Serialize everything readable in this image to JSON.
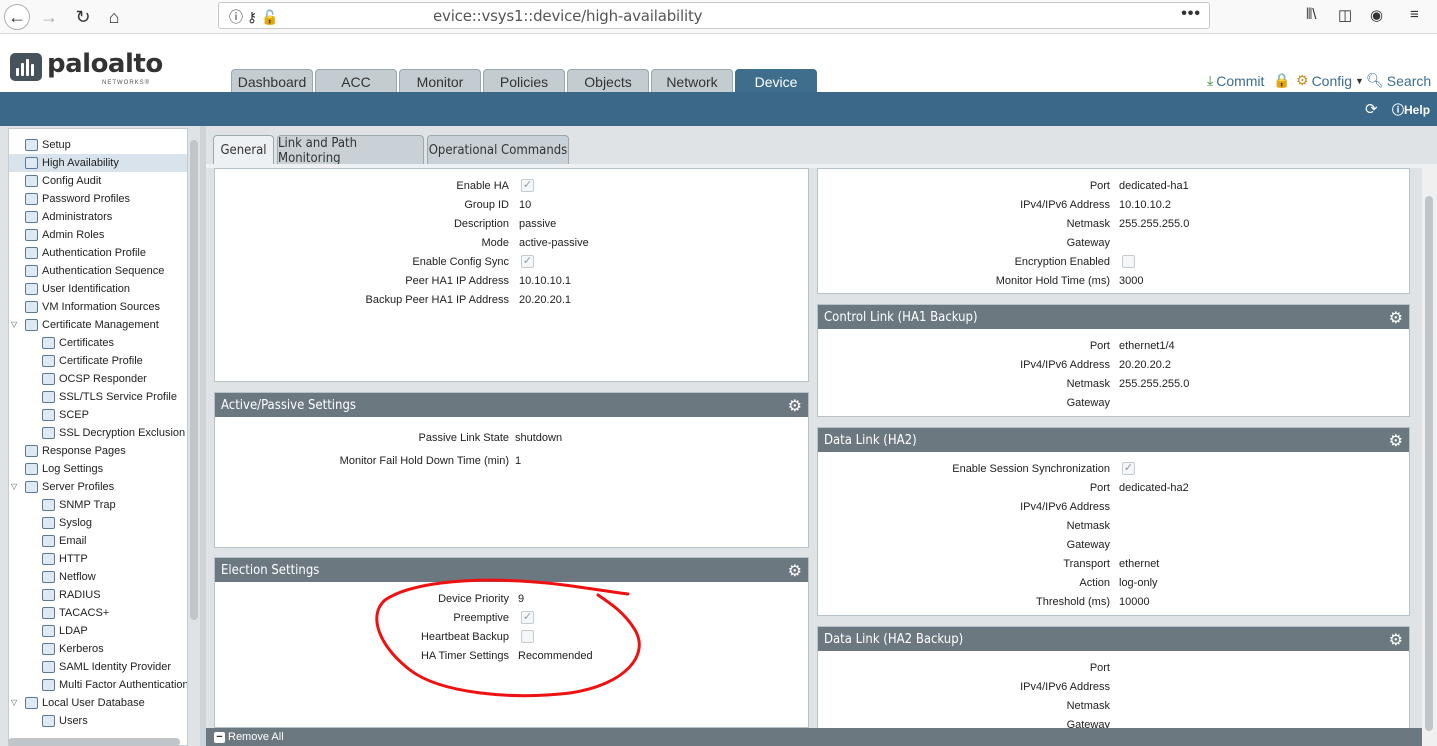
{
  "browser": {
    "url": "evice::vsys1::device/high-availability",
    "more": "•••"
  },
  "brand": {
    "name": "paloalto",
    "sub": "NETWORKS®"
  },
  "main_tabs": [
    {
      "label": "Dashboard"
    },
    {
      "label": "ACC"
    },
    {
      "label": "Monitor"
    },
    {
      "label": "Policies"
    },
    {
      "label": "Objects"
    },
    {
      "label": "Network"
    },
    {
      "label": "Device"
    }
  ],
  "header_actions": {
    "commit": "Commit",
    "config": "Config",
    "search": "Search",
    "help": "Help"
  },
  "sidebar": [
    "Setup",
    "High Availability",
    "Config Audit",
    "Password Profiles",
    "Administrators",
    "Admin Roles",
    "Authentication Profile",
    "Authentication Sequence",
    "User Identification",
    "VM Information Sources",
    "Certificate Management",
    "Certificates",
    "Certificate Profile",
    "OCSP Responder",
    "SSL/TLS Service Profile",
    "SCEP",
    "SSL Decryption Exclusion",
    "Response Pages",
    "Log Settings",
    "Server Profiles",
    "SNMP Trap",
    "Syslog",
    "Email",
    "HTTP",
    "Netflow",
    "RADIUS",
    "TACACS+",
    "LDAP",
    "Kerberos",
    "SAML Identity Provider",
    "Multi Factor Authentication",
    "Local User Database",
    "Users"
  ],
  "sub_tabs": [
    "General",
    "Link and Path Monitoring",
    "Operational Commands"
  ],
  "setup": {
    "enable_ha_label": "Enable HA",
    "group_id_label": "Group ID",
    "group_id": "10",
    "description_label": "Description",
    "description": "passive",
    "mode_label": "Mode",
    "mode": "active-passive",
    "config_sync_label": "Enable Config Sync",
    "peer_ha1_label": "Peer HA1 IP Address",
    "peer_ha1": "10.10.10.1",
    "backup_peer_label": "Backup Peer HA1 IP Address",
    "backup_peer": "20.20.20.1"
  },
  "active_passive": {
    "title": "Active/Passive Settings",
    "link_state_label": "Passive Link State",
    "link_state": "shutdown",
    "hold_label": "Monitor Fail Hold Down Time (min)",
    "hold": "1"
  },
  "election": {
    "title": "Election Settings",
    "priority_label": "Device Priority",
    "priority": "9",
    "preemptive_label": "Preemptive",
    "heartbeat_label": "Heartbeat Backup",
    "timer_label": "HA Timer Settings",
    "timer": "Recommended"
  },
  "ha1": {
    "port_label": "Port",
    "port": "dedicated-ha1",
    "ip_label": "IPv4/IPv6 Address",
    "ip": "10.10.10.2",
    "netmask_label": "Netmask",
    "netmask": "255.255.255.0",
    "gateway_label": "Gateway",
    "encryption_label": "Encryption Enabled",
    "hold_label": "Monitor Hold Time (ms)",
    "hold": "3000"
  },
  "ha1_backup": {
    "title": "Control Link (HA1 Backup)",
    "port_label": "Port",
    "port": "ethernet1/4",
    "ip_label": "IPv4/IPv6 Address",
    "ip": "20.20.20.2",
    "netmask_label": "Netmask",
    "netmask": "255.255.255.0",
    "gateway_label": "Gateway"
  },
  "ha2": {
    "title": "Data Link (HA2)",
    "sync_label": "Enable Session Synchronization",
    "port_label": "Port",
    "port": "dedicated-ha2",
    "ip_label": "IPv4/IPv6 Address",
    "netmask_label": "Netmask",
    "gateway_label": "Gateway",
    "transport_label": "Transport",
    "transport": "ethernet",
    "action_label": "Action",
    "action": "log-only",
    "threshold_label": "Threshold (ms)",
    "threshold": "10000"
  },
  "ha2_backup": {
    "title": "Data Link (HA2 Backup)",
    "port_label": "Port",
    "ip_label": "IPv4/IPv6 Address",
    "netmask_label": "Netmask",
    "gateway_label": "Gateway"
  },
  "footer": {
    "remove_all": "Remove All"
  },
  "colors": {
    "accent": "#3b6889",
    "panel_header": "#6b7880",
    "annotation": "#ee1111"
  }
}
